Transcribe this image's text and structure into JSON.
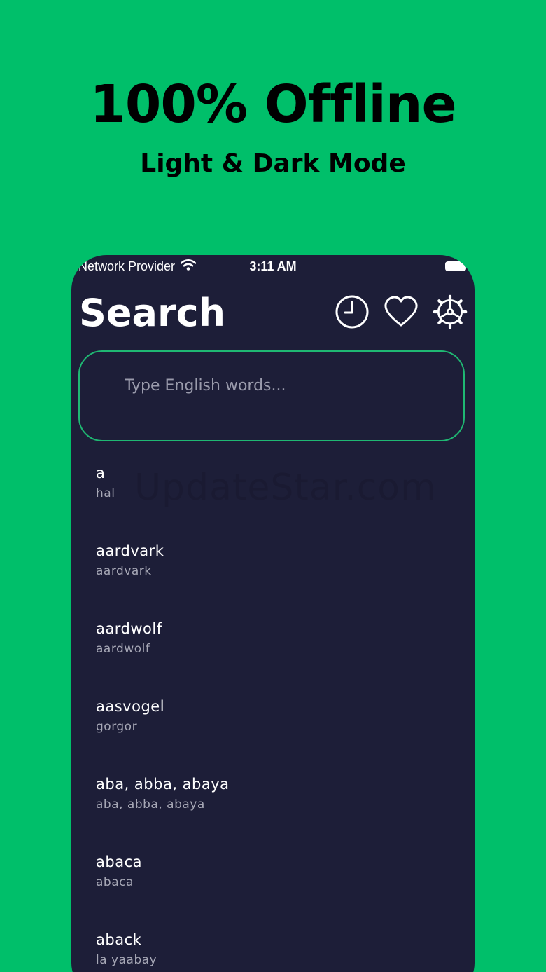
{
  "promo": {
    "title": "100% Offline",
    "subtitle": "Light & Dark Mode"
  },
  "status_bar": {
    "carrier": "Network Provider",
    "time": "3:11 AM"
  },
  "header": {
    "title": "Search",
    "icons": [
      "history-icon",
      "favorites-icon",
      "settings-icon"
    ]
  },
  "search": {
    "placeholder": "Type English words...",
    "value": ""
  },
  "watermark": "UpdateStar.com",
  "words": [
    {
      "term": "a",
      "translation": "hal"
    },
    {
      "term": "aardvark",
      "translation": "aardvark"
    },
    {
      "term": "aardwolf",
      "translation": "aardwolf"
    },
    {
      "term": "aasvogel",
      "translation": "gorgor"
    },
    {
      "term": "aba, abba, abaya",
      "translation": "aba, abba, abaya"
    },
    {
      "term": "abaca",
      "translation": "abaca"
    },
    {
      "term": "aback",
      "translation": "la yaabay"
    }
  ],
  "colors": {
    "background": "#00BF6A",
    "surface": "#1D1E38",
    "accent": "#1FB873",
    "text_primary": "#FFFFFF",
    "text_secondary": "#A7A8B6"
  }
}
